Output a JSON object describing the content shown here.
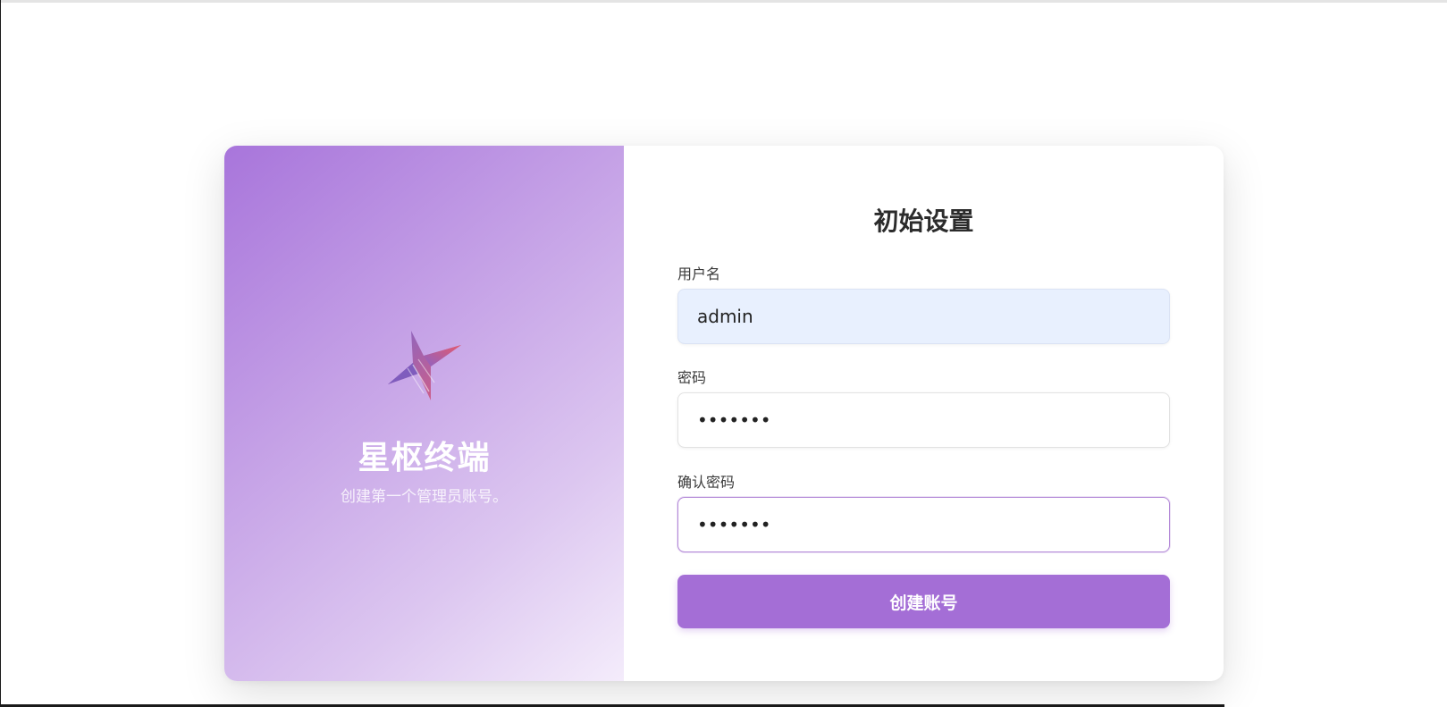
{
  "brand": {
    "logo_icon": "star-logo-icon",
    "name": "星枢终端",
    "subtitle": "创建第一个管理员账号。"
  },
  "form": {
    "title": "初始设置",
    "username": {
      "label": "用户名",
      "value": "admin"
    },
    "password": {
      "label": "密码",
      "value": "•••••••"
    },
    "confirm_password": {
      "label": "确认密码",
      "value": "•••••••"
    },
    "submit_label": "创建账号"
  },
  "colors": {
    "accent": "#a46ed6",
    "brand_gradient_start": "#a875db",
    "brand_gradient_end": "#f4ecfb",
    "autofill_bg": "#e8f0fe"
  }
}
